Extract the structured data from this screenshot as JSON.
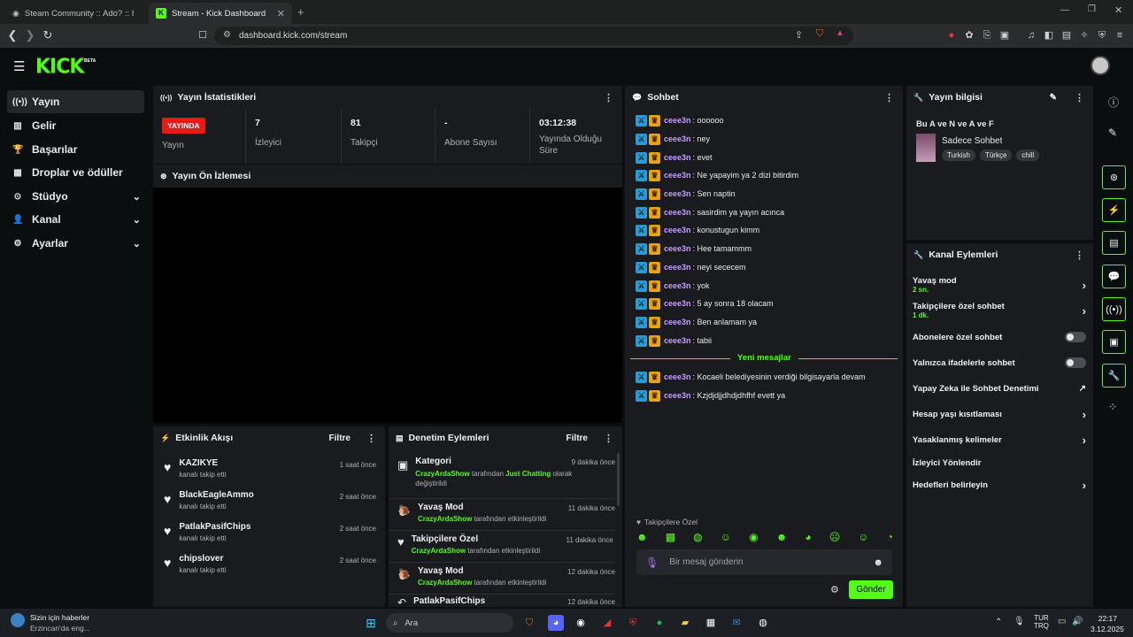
{
  "browser": {
    "tabs": [
      {
        "title": "Steam Community :: Ado? :: Item Inv"
      },
      {
        "title": "Stream - Kick Dashboard"
      }
    ],
    "url": "dashboard.kick.com/stream"
  },
  "header": {
    "logo": "KICK",
    "beta": "BETA"
  },
  "sidebar": {
    "items": [
      {
        "label": "Yayın",
        "icon": "broadcast-icon"
      },
      {
        "label": "Gelir",
        "icon": "revenue-icon"
      },
      {
        "label": "Başarılar",
        "icon": "trophy-icon"
      },
      {
        "label": "Droplar ve ödüller",
        "icon": "gift-icon"
      },
      {
        "label": "Stüdyo",
        "icon": "studio-icon"
      },
      {
        "label": "Kanal",
        "icon": "user-icon"
      },
      {
        "label": "Ayarlar",
        "icon": "gear-icon"
      }
    ]
  },
  "stats": {
    "title": "Yayın İstatistikleri",
    "live_badge": "YAYINDA",
    "live_label": "Yayın",
    "viewers_value": "7",
    "viewers_label": "İzleyici",
    "followers_value": "81",
    "followers_label": "Takipçi",
    "subs_value": "-",
    "subs_label": "Abone Sayısı",
    "uptime_value": "03:12:38",
    "uptime_label": "Yayında Olduğu Süre"
  },
  "preview": {
    "title": "Yayın Ön İzlemesi"
  },
  "activity": {
    "title": "Etkinlik Akışı",
    "filter": "Filtre",
    "items": [
      {
        "name": "KAZIKYE",
        "sub": "kanalı takip etti",
        "time": "1 saat önce"
      },
      {
        "name": "BlackEagleAmmo",
        "sub": "kanalı takip etti",
        "time": "2 saat önce"
      },
      {
        "name": "PatlakPasifChips",
        "sub": "kanalı takip etti",
        "time": "2 saat önce"
      },
      {
        "name": "chipslover",
        "sub": "kanalı takip etti",
        "time": "2 saat önce"
      }
    ]
  },
  "moderation": {
    "title": "Denetim Eylemleri",
    "filter": "Filtre",
    "items": [
      {
        "title": "Kategori",
        "time": "9 dakika önce",
        "actor": "CrazyArdaShow",
        "pre": " tarafından ",
        "target": "Just Chatting",
        "post": " olarak değiştirildi"
      },
      {
        "title": "Yavaş Mod",
        "time": "11 dakika önce",
        "actor": "CrazyArdaShow",
        "pre": " tarafından etkinleştirildi",
        "target": "",
        "post": ""
      },
      {
        "title": "Takipçilere Özel",
        "time": "11 dakika önce",
        "actor": "CrazyArdaShow",
        "pre": " tarafından etkinleştirildi",
        "target": "",
        "post": ""
      },
      {
        "title": "Yavaş Mod",
        "time": "12 dakika önce",
        "actor": "CrazyArdaShow",
        "pre": " tarafından etkinleştirildi",
        "target": "",
        "post": ""
      },
      {
        "title": "PatlakPasifChips",
        "time": "12 dakika önce",
        "actor": "",
        "pre": "",
        "target": "",
        "post": ""
      }
    ]
  },
  "chat": {
    "title": "Sohbet",
    "messages": [
      {
        "user": "ceee3n",
        "text": ": oooooo"
      },
      {
        "user": "ceee3n",
        "text": ": ney"
      },
      {
        "user": "ceee3n",
        "text": ": evet"
      },
      {
        "user": "ceee3n",
        "text": ": Ne yapayim ya 2 dizi bitirdim"
      },
      {
        "user": "ceee3n",
        "text": ": Sen naptin"
      },
      {
        "user": "ceee3n",
        "text": ": sasirdim ya yayın acınca"
      },
      {
        "user": "ceee3n",
        "text": ": konustugun kimm"
      },
      {
        "user": "ceee3n",
        "text": ": Hee tamammm"
      },
      {
        "user": "ceee3n",
        "text": ": neyi sececem"
      },
      {
        "user": "ceee3n",
        "text": ": yok"
      },
      {
        "user": "ceee3n",
        "text": ": 5 ay sonra 18 olacam"
      },
      {
        "user": "ceee3n",
        "text": ": Ben anlamam ya"
      },
      {
        "user": "ceee3n",
        "text": ": tabii"
      }
    ],
    "new_divider": "Yeni mesajlar",
    "new_messages": [
      {
        "user": "ceee3n",
        "text": ": Kocaeli belediyesinin verdiği bilgisayarla devam"
      },
      {
        "user": "ceee3n",
        "text": ": Kzjdjdjjdhdjdhfhf evett ya"
      }
    ],
    "followers_only": "Takipçilere Özel",
    "input_placeholder": "Bir mesaj gönderin",
    "send": "Gönder"
  },
  "stream_info": {
    "title": "Yayın bilgisi",
    "stream_title": "Bu A ve N ve A ve F",
    "category": "Sadece Sohbet",
    "tags": [
      "Turkish",
      "Türkçe",
      "chill"
    ]
  },
  "channel_actions": {
    "title": "Kanal Eylemleri",
    "slow_mode": "Yavaş mod",
    "slow_mode_value": "2 sn.",
    "followers_only": "Takipçilere özel sohbet",
    "followers_only_value": "1 dk.",
    "subs_only": "Abonelere özel sohbet",
    "emotes_only": "Yalnızca ifadelerle sohbet",
    "ai_moderation": "Yapay Zeka ile Sohbet Denetimi",
    "age_restriction": "Hesap yaşı kısıtlaması",
    "banned_words": "Yasaklanmış kelimeler",
    "raid": "İzleyici Yönlendir",
    "goals": "Hedefleri belirleyin"
  },
  "taskbar": {
    "news_title": "Sizin için haberler",
    "news_sub": "Erzincan'da eng...",
    "search": "Ara",
    "lang1": "TUR",
    "lang2": "TRQ",
    "time": "22:17",
    "date": "3.12.2025"
  },
  "colors": {
    "accent": "#53fc18",
    "panel": "#191b1f",
    "bg": "#0b0e0f",
    "live": "#e91916"
  }
}
